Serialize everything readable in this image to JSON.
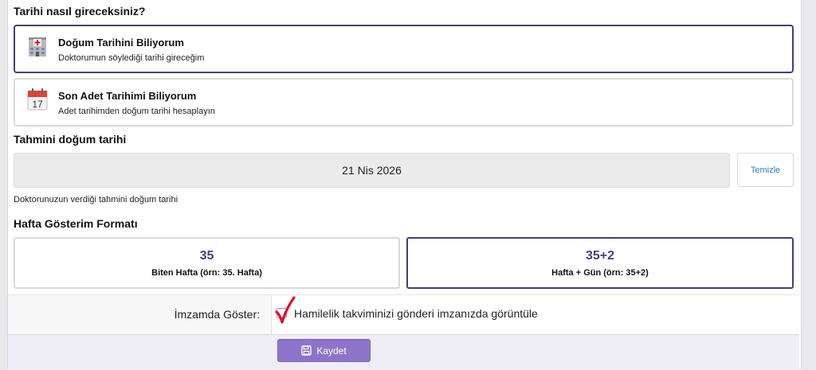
{
  "entry_method": {
    "heading": "Tarihi nasıl gireceksiniz?",
    "options": [
      {
        "title": "Doğum Tarihini Biliyorum",
        "description": "Doktorumun söylediği tarihi gireceğim",
        "icon": "hospital-icon",
        "selected": true
      },
      {
        "title": "Son Adet Tarihimi Biliyorum",
        "description": "Adet tarihimden doğum tarihi hesaplayın",
        "icon": "calendar-icon",
        "calendar_day": "17",
        "selected": false
      }
    ]
  },
  "due_date": {
    "heading": "Tahmini doğum tarihi",
    "value": "21 Nis 2026",
    "clear_label": "Temizle",
    "hint": "Doktorunuzun verdiği tahmini doğum tarihi"
  },
  "week_format": {
    "heading": "Hafta Gösterim Formatı",
    "options": [
      {
        "value": "35",
        "label": "Biten Hafta (örn: 35. Hafta)",
        "selected": false
      },
      {
        "value": "35+2",
        "label": "Hafta + Gün (örn: 35+2)",
        "selected": true
      }
    ]
  },
  "signature": {
    "label": "İmzamda Göster:",
    "checkbox_text": "Hamilelik takviminizi gönderi imzanızda görüntüle",
    "checked": true
  },
  "footer": {
    "save_label": "Kaydet",
    "save_icon": "floppy-disk-icon"
  },
  "colors": {
    "accent": "#4b3b78",
    "button": "#8e74c8",
    "link": "#2b7fc2",
    "checkmark": "#e0102d"
  }
}
